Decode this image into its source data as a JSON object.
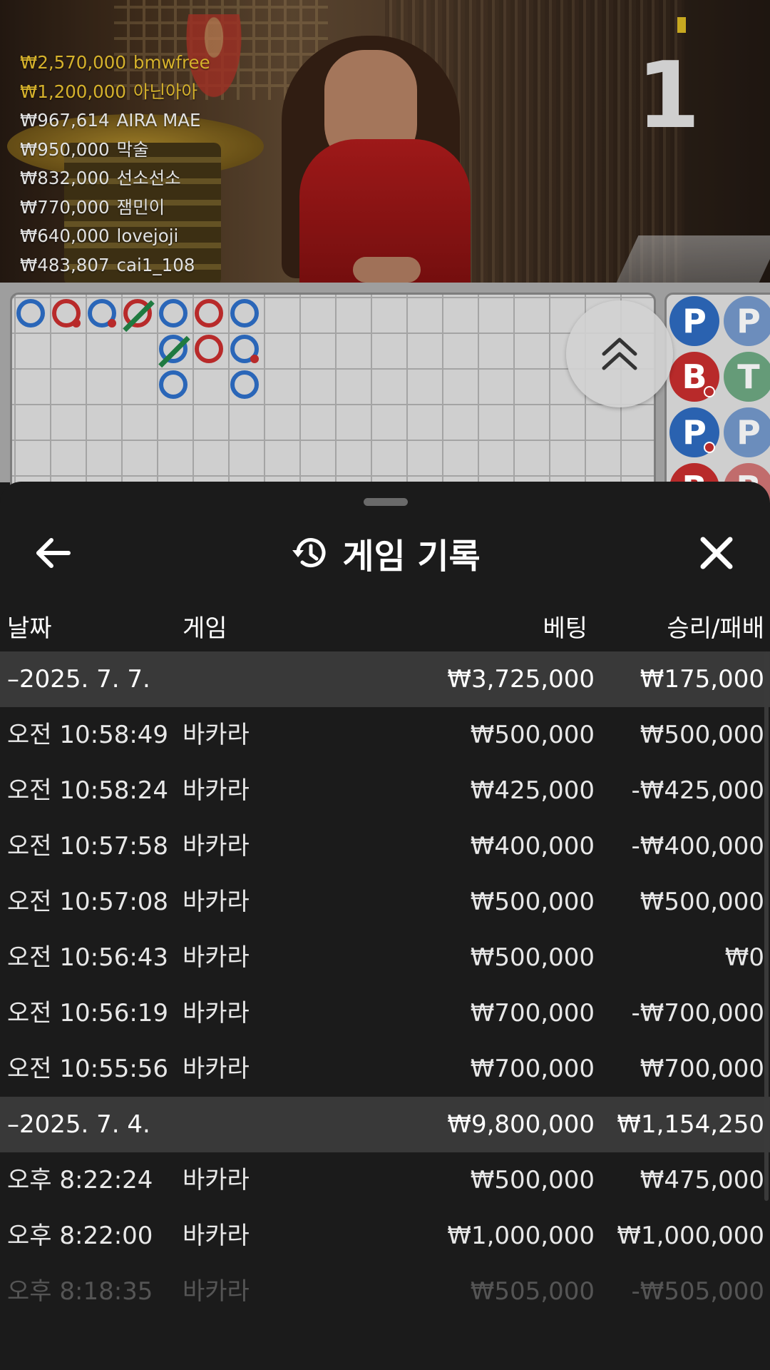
{
  "video": {
    "round_number": "1",
    "leaderboard": [
      {
        "amount": "₩2,570,000",
        "name": "bmwfree",
        "highlight": true
      },
      {
        "amount": "₩1,200,000",
        "name": "아닌아아",
        "highlight": true
      },
      {
        "amount": "₩967,614",
        "name": "AIRA MAE",
        "highlight": false
      },
      {
        "amount": "₩950,000",
        "name": "막술",
        "highlight": false
      },
      {
        "amount": "₩832,000",
        "name": "선소선소",
        "highlight": false
      },
      {
        "amount": "₩770,000",
        "name": "잼민이",
        "highlight": false
      },
      {
        "amount": "₩640,000",
        "name": "lovejoji",
        "highlight": false
      },
      {
        "amount": "₩483,807",
        "name": "cai1_108",
        "highlight": false
      }
    ]
  },
  "roadmap": {
    "big_road": [
      {
        "col": 0,
        "row": 0,
        "color": "blue",
        "mark": ""
      },
      {
        "col": 1,
        "row": 0,
        "color": "red",
        "mark": "dot-red"
      },
      {
        "col": 2,
        "row": 0,
        "color": "blue",
        "mark": "dot-red"
      },
      {
        "col": 3,
        "row": 0,
        "color": "red",
        "mark": "slash"
      },
      {
        "col": 4,
        "row": 0,
        "color": "blue",
        "mark": ""
      },
      {
        "col": 4,
        "row": 1,
        "color": "blue",
        "mark": "slash"
      },
      {
        "col": 4,
        "row": 2,
        "color": "blue",
        "mark": ""
      },
      {
        "col": 5,
        "row": 0,
        "color": "red",
        "mark": ""
      },
      {
        "col": 5,
        "row": 1,
        "color": "red",
        "mark": ""
      },
      {
        "col": 6,
        "row": 0,
        "color": "blue",
        "mark": ""
      },
      {
        "col": 6,
        "row": 1,
        "color": "blue",
        "mark": "dot-red"
      },
      {
        "col": 6,
        "row": 2,
        "color": "blue",
        "mark": ""
      }
    ],
    "bead_road": [
      {
        "col": 0,
        "row": 0,
        "letter": "P",
        "type": "p",
        "dot": "",
        "faded": false
      },
      {
        "col": 0,
        "row": 1,
        "letter": "B",
        "type": "b",
        "dot": "red",
        "faded": false
      },
      {
        "col": 0,
        "row": 2,
        "letter": "P",
        "type": "p",
        "dot": "red",
        "faded": false
      },
      {
        "col": 0,
        "row": 3,
        "letter": "B",
        "type": "b",
        "dot": "",
        "faded": false
      },
      {
        "col": 1,
        "row": 0,
        "letter": "P",
        "type": "p",
        "dot": "",
        "faded": true
      },
      {
        "col": 1,
        "row": 1,
        "letter": "T",
        "type": "t",
        "dot": "",
        "faded": true
      },
      {
        "col": 1,
        "row": 2,
        "letter": "P",
        "type": "p",
        "dot": "",
        "faded": true
      },
      {
        "col": 1,
        "row": 3,
        "letter": "B",
        "type": "b",
        "dot": "",
        "faded": true
      }
    ]
  },
  "sheet": {
    "title": "게임 기록",
    "icons": {
      "back": "arrow-left-icon",
      "history": "history-clock-icon",
      "close": "close-icon",
      "expand": "chevron-double-up-icon"
    },
    "columns": {
      "date": "날짜",
      "game": "게임",
      "bet": "베팅",
      "result": "승리/패배"
    },
    "rows": [
      {
        "kind": "group",
        "date": "–2025. 7. 7.",
        "game": "",
        "bet": "₩3,725,000",
        "result": "₩175,000"
      },
      {
        "kind": "item",
        "date": "오전 10:58:49",
        "game": "바카라",
        "bet": "₩500,000",
        "result": "₩500,000"
      },
      {
        "kind": "item",
        "date": "오전 10:58:24",
        "game": "바카라",
        "bet": "₩425,000",
        "result": "-₩425,000"
      },
      {
        "kind": "item",
        "date": "오전 10:57:58",
        "game": "바카라",
        "bet": "₩400,000",
        "result": "-₩400,000"
      },
      {
        "kind": "item",
        "date": "오전 10:57:08",
        "game": "바카라",
        "bet": "₩500,000",
        "result": "₩500,000"
      },
      {
        "kind": "item",
        "date": "오전 10:56:43",
        "game": "바카라",
        "bet": "₩500,000",
        "result": "₩0"
      },
      {
        "kind": "item",
        "date": "오전 10:56:19",
        "game": "바카라",
        "bet": "₩700,000",
        "result": "-₩700,000"
      },
      {
        "kind": "item",
        "date": "오전 10:55:56",
        "game": "바카라",
        "bet": "₩700,000",
        "result": "₩700,000"
      },
      {
        "kind": "group",
        "date": "–2025. 7. 4.",
        "game": "",
        "bet": "₩9,800,000",
        "result": "₩1,154,250"
      },
      {
        "kind": "item",
        "date": "오후 8:22:24",
        "game": "바카라",
        "bet": "₩500,000",
        "result": "₩475,000"
      },
      {
        "kind": "item",
        "date": "오후 8:22:00",
        "game": "바카라",
        "bet": "₩1,000,000",
        "result": "₩1,000,000"
      },
      {
        "kind": "fade",
        "date": "오후 8:18:35",
        "game": "바카라",
        "bet": "₩505,000",
        "result": "-₩505,000"
      }
    ]
  },
  "colors": {
    "banker": "#b82a2a",
    "player": "#2a62b0",
    "tie": "#1f7a40",
    "gold_text": "#d6b22c",
    "sheet_bg": "#1b1b1b",
    "group_row_bg": "#393939"
  }
}
